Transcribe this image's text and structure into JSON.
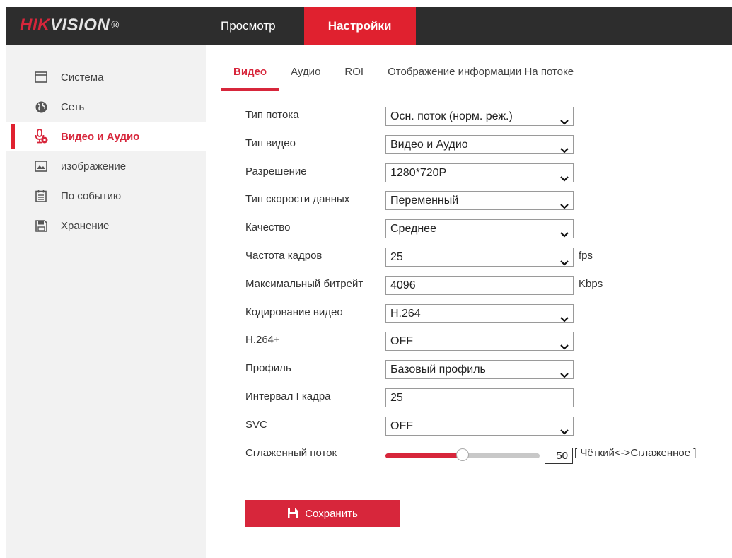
{
  "brand": {
    "hik": "HIK",
    "vision": "VISION",
    "reg": "®"
  },
  "topnav": [
    {
      "label": "Просмотр"
    },
    {
      "label": "Настройки"
    }
  ],
  "sidebar": {
    "items": [
      {
        "label": "Система",
        "icon": "system-window-icon"
      },
      {
        "label": "Сеть",
        "icon": "globe-icon"
      },
      {
        "label": "Видео и Аудио",
        "icon": "microphone-icon"
      },
      {
        "label": "изображение",
        "icon": "image-icon"
      },
      {
        "label": "По событию",
        "icon": "calendar-icon"
      },
      {
        "label": "Хранение",
        "icon": "floppy-disk-icon"
      }
    ],
    "active_index": 2
  },
  "tabs": [
    {
      "label": "Видео"
    },
    {
      "label": "Аудио"
    },
    {
      "label": "ROI"
    },
    {
      "label": "Отображение информации На потоке"
    }
  ],
  "form": {
    "stream_type": {
      "label": "Тип потока",
      "value": "Осн. поток (норм. реж.)"
    },
    "video_type": {
      "label": "Тип видео",
      "value": "Видео и Аудио"
    },
    "resolution": {
      "label": "Разрешение",
      "value": "1280*720P"
    },
    "bitrate_type": {
      "label": "Тип скорости данных",
      "value": "Переменный"
    },
    "quality": {
      "label": "Качество",
      "value": "Среднее"
    },
    "frame_rate": {
      "label": "Частота кадров",
      "value": "25",
      "unit": "fps"
    },
    "max_bitrate": {
      "label": "Максимальный битрейт",
      "value": "4096",
      "unit": "Kbps"
    },
    "video_encoding": {
      "label": "Кодирование видео",
      "value": "H.264"
    },
    "h264_plus": {
      "label": "H.264+",
      "value": "OFF"
    },
    "profile": {
      "label": "Профиль",
      "value": "Базовый профиль"
    },
    "i_frame_interval": {
      "label": "Интервал I кадра",
      "value": "25"
    },
    "svc": {
      "label": "SVC",
      "value": "OFF"
    },
    "smoothing": {
      "label": "Сглаженный поток",
      "value": "50",
      "fraction": 0.5,
      "hint": "[ Чёткий<->Сглаженное ]"
    }
  },
  "save_button": {
    "label": "Сохранить"
  },
  "colors": {
    "accent": "#d7263b",
    "topbar": "#2d2d2d",
    "sidebar": "#f2f2f2"
  }
}
